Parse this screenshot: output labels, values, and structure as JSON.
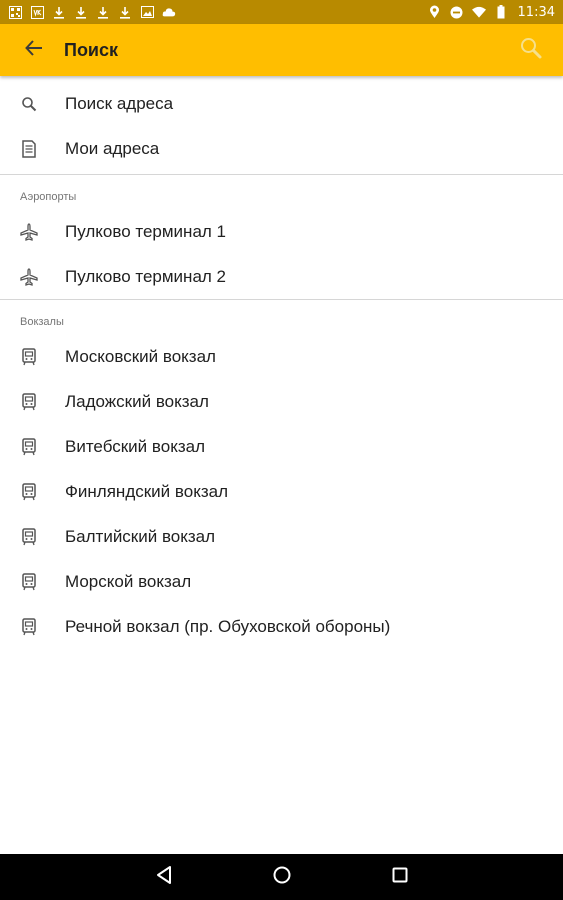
{
  "status_bar": {
    "time": "11:34",
    "left_icons": [
      "qr-icon",
      "vk-icon",
      "download-icon",
      "download-icon",
      "download-icon",
      "download-icon",
      "image-icon",
      "cloud-icon"
    ],
    "right_icons": [
      "location-icon",
      "do-not-disturb-icon",
      "wifi-icon",
      "battery-icon"
    ]
  },
  "app_bar": {
    "title": "Поиск",
    "background": "#ffbe00"
  },
  "top_items": [
    {
      "label": "Поиск адреса",
      "icon": "search-icon"
    },
    {
      "label": "Мои адреса",
      "icon": "document-icon"
    }
  ],
  "sections": [
    {
      "header": "Аэропорты",
      "items": [
        {
          "label": "Пулково терминал 1",
          "icon": "airplane-icon"
        },
        {
          "label": "Пулково терминал 2",
          "icon": "airplane-icon"
        }
      ]
    },
    {
      "header": "Вокзалы",
      "items": [
        {
          "label": "Московский вокзал",
          "icon": "train-icon"
        },
        {
          "label": "Ладожский вокзал",
          "icon": "train-icon"
        },
        {
          "label": "Витебский вокзал",
          "icon": "train-icon"
        },
        {
          "label": "Финляндский вокзал",
          "icon": "train-icon"
        },
        {
          "label": "Балтийский вокзал",
          "icon": "train-icon"
        },
        {
          "label": "Морской вокзал",
          "icon": "train-icon"
        },
        {
          "label": "Речной вокзал (пр. Обуховской обороны)",
          "icon": "train-icon"
        }
      ]
    }
  ],
  "nav_bar": {
    "buttons": [
      "back-triangle-icon",
      "home-circle-icon",
      "recents-square-icon"
    ]
  }
}
